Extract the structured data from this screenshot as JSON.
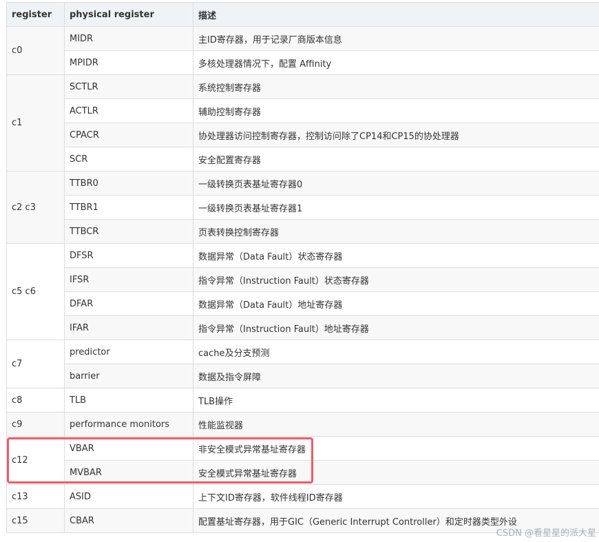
{
  "table": {
    "headers": [
      "register",
      "physical register",
      "描述"
    ],
    "groups": [
      {
        "register": "c0",
        "rows": [
          {
            "physical": "MIDR",
            "desc": "主ID寄存器，用于记录厂商版本信息"
          },
          {
            "physical": "MPIDR",
            "desc": "多核处理器情况下，配置 Affinity"
          }
        ]
      },
      {
        "register": "c1",
        "rows": [
          {
            "physical": "SCTLR",
            "desc": "系统控制寄存器"
          },
          {
            "physical": "ACTLR",
            "desc": "辅助控制寄存器"
          },
          {
            "physical": "CPACR",
            "desc": "协处理器访问控制寄存器，控制访问除了CP14和CP15的协处理器"
          },
          {
            "physical": "SCR",
            "desc": "安全配置寄存器"
          }
        ]
      },
      {
        "register": "c2 c3",
        "rows": [
          {
            "physical": "TTBR0",
            "desc": "一级转换页表基址寄存器0"
          },
          {
            "physical": "TTBR1",
            "desc": "一级转换页表基址寄存器1"
          },
          {
            "physical": "TTBCR",
            "desc": "页表转换控制寄存器"
          }
        ]
      },
      {
        "register": "c5 c6",
        "rows": [
          {
            "physical": "DFSR",
            "desc": "数据异常（Data Fault）状态寄存器"
          },
          {
            "physical": "IFSR",
            "desc": "指令异常（Instruction Fault）状态寄存器"
          },
          {
            "physical": "DFAR",
            "desc": "数据异常（Data Fault）地址寄存器"
          },
          {
            "physical": "IFAR",
            "desc": "指令异常（Instruction Fault）地址寄存器"
          }
        ]
      },
      {
        "register": "c7",
        "rows": [
          {
            "physical": "predictor",
            "desc": "cache及分支预测"
          },
          {
            "physical": "barrier",
            "desc": "数据及指令屏障"
          }
        ]
      },
      {
        "register": "c8",
        "rows": [
          {
            "physical": "TLB",
            "desc": "TLB操作"
          }
        ]
      },
      {
        "register": "c9",
        "rows": [
          {
            "physical": "performance monitors",
            "desc": "性能监视器"
          }
        ]
      },
      {
        "register": "c12",
        "highlighted": true,
        "rows": [
          {
            "physical": "VBAR",
            "desc": "非安全模式异常基址寄存器"
          },
          {
            "physical": "MVBAR",
            "desc": "安全模式异常基址寄存器"
          }
        ]
      },
      {
        "register": "c13",
        "rows": [
          {
            "physical": "ASID",
            "desc": "上下文ID寄存器，软件线程ID寄存器"
          }
        ]
      },
      {
        "register": "c15",
        "rows": [
          {
            "physical": "CBAR",
            "desc": "配置基址寄存器，用于GIC（Generic Interrupt Controller）和定时器类型外设"
          }
        ]
      }
    ]
  },
  "highlight_color": "#f05a6a",
  "watermark": "CSDN @看星星的派大星"
}
